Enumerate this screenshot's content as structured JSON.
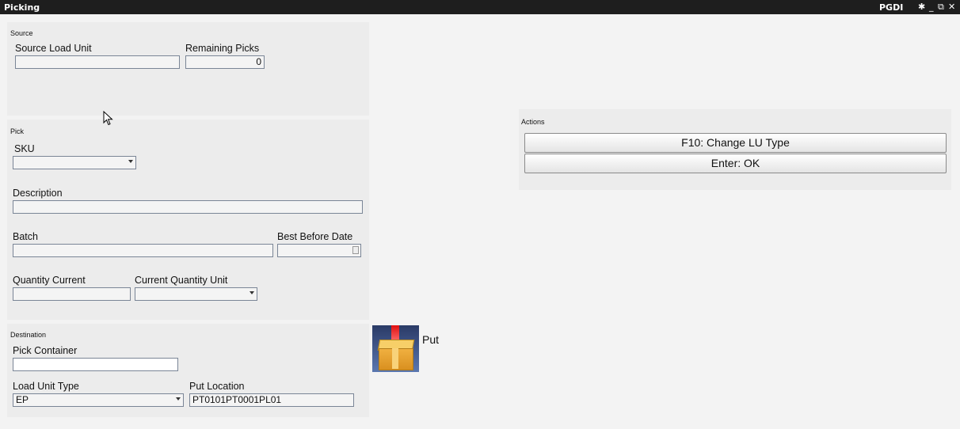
{
  "window": {
    "title": "Picking",
    "user": "PGDI",
    "controls": {
      "pin": "✱",
      "minimize": "_",
      "restore": "⧉",
      "close": "✕"
    }
  },
  "source": {
    "section_title": "Source",
    "load_unit_label": "Source Load Unit",
    "load_unit_value": "",
    "remaining_label": "Remaining Picks",
    "remaining_value": "0"
  },
  "pick": {
    "section_title": "Pick",
    "sku_label": "SKU",
    "sku_value": "",
    "description_label": "Description",
    "description_value": "",
    "batch_label": "Batch",
    "batch_value": "",
    "best_before_label": "Best Before Date",
    "best_before_value": "",
    "qty_label": "Quantity Current",
    "qty_value": "",
    "qty_unit_label": "Current Quantity Unit",
    "qty_unit_value": ""
  },
  "destination": {
    "section_title": "Destination",
    "pick_container_label": "Pick Container",
    "pick_container_value": "",
    "lu_type_label": "Load Unit Type",
    "lu_type_value": "EP",
    "put_location_label": "Put Location",
    "put_location_value": "PT0101PT0001PL01"
  },
  "put": {
    "label": "Put",
    "icon": "box-scan-icon"
  },
  "actions": {
    "section_title": "Actions",
    "buttons": [
      "F10: Change LU Type",
      "Enter: OK"
    ]
  }
}
